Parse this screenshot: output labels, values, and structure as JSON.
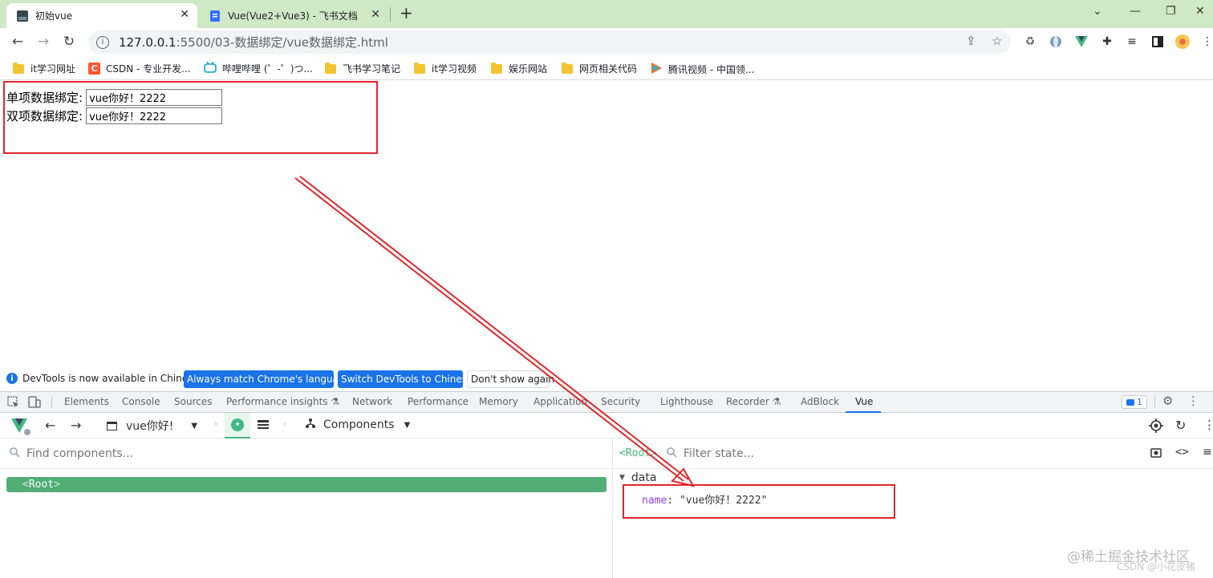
{
  "browser": {
    "tabs": [
      {
        "title": "初始vue",
        "active": true
      },
      {
        "title": "Vue(Vue2+Vue3) - 飞书文档",
        "active": false
      }
    ],
    "new_tab": "+",
    "url_host": "127.0.0.1",
    "url_path": ":5500/03-数据绑定/vue数据绑定.html",
    "bookmarks": [
      {
        "label": "it学习网址",
        "icon": "folder-icon"
      },
      {
        "label": "CSDN - 专业开发...",
        "icon": "csdn-icon"
      },
      {
        "label": "哔哩哔哩 (゜-゜)つ...",
        "icon": "bilibili-icon"
      },
      {
        "label": "飞书学习笔记",
        "icon": "folder-icon"
      },
      {
        "label": "it学习视频",
        "icon": "folder-icon"
      },
      {
        "label": "娱乐网站",
        "icon": "folder-icon"
      },
      {
        "label": "网页相关代码",
        "icon": "folder-icon"
      },
      {
        "label": "腾讯视频 - 中国领...",
        "icon": "tencent-video-icon"
      }
    ]
  },
  "page": {
    "one_way_label": "单项数据绑定:",
    "one_way_value": "vue你好！2222",
    "two_way_label": "双项数据绑定:",
    "two_way_value": "vue你好！2222"
  },
  "devtools": {
    "infobar_text": "DevTools is now available in Chinese!",
    "btn_match": "Always match Chrome's language",
    "btn_switch": "Switch DevTools to Chinese",
    "btn_dont_show": "Don't show again",
    "tabs": [
      "Elements",
      "Console",
      "Sources",
      "Performance insights",
      "Network",
      "Performance",
      "Memory",
      "Application",
      "Security",
      "Lighthouse",
      "Recorder",
      "AdBlock",
      "Vue"
    ],
    "active_tab": "Vue",
    "issues_count": "1",
    "vue": {
      "app_selector": "vue你好!",
      "components_label": "Components",
      "find_placeholder": "Find components...",
      "root_label": "Root",
      "breadcrumb": "<Root>",
      "filter_placeholder": "Filter state...",
      "section_label": "data",
      "prop_name": "name",
      "prop_value": "\"vue你好！2222\""
    }
  },
  "watermark": {
    "line1": "@稀土掘金技术社区",
    "line2": "CSDN @小花皮猪"
  },
  "colors": {
    "tab_bar": "#cfe8c6",
    "annotation_red": "#e0262b",
    "vue_green": "#52ad77",
    "devtools_blue": "#1a73e8"
  }
}
